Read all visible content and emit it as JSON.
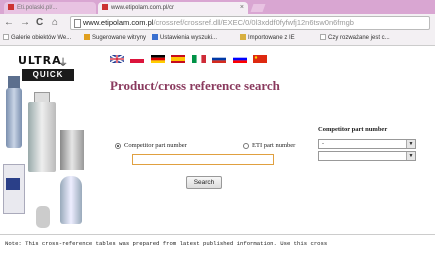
{
  "browser": {
    "tabs": [
      {
        "label": "Eti.polaski.pl/...",
        "active": false
      },
      {
        "label": "www.etipolam.com.pl/cr",
        "active": true
      }
    ],
    "nav": {
      "back": "←",
      "forward": "→",
      "reload": "C",
      "home": "⌂"
    },
    "url_host": "www.etipolam.com.pl",
    "url_path": "/crossref/crossref.dll/EXEC/0/0l3xddf0fyfwfj12n6tsw0n6fmgb",
    "bookmarks": [
      {
        "label": "Galerie obiektów We...",
        "color": "#ffffff"
      },
      {
        "label": "Sugerowane witryny",
        "color": "#e0a020"
      },
      {
        "label": "Ustawienia wyszuki...",
        "color": "#3a6fd0"
      },
      {
        "label": "Importowane z IE",
        "color": "#d8b040"
      },
      {
        "label": "Czy rozważane jest c...",
        "color": "#ffffff"
      }
    ]
  },
  "logo": {
    "top": "ULTRA",
    "bottom": "QUICK"
  },
  "flags": [
    {
      "name": "uk-flag",
      "colors": [
        "#1f3a93",
        "#cf142b",
        "#ffffff"
      ]
    },
    {
      "name": "poland-flag",
      "colors": [
        "#ffffff",
        "#dc143c"
      ]
    },
    {
      "name": "germany-flag",
      "colors": [
        "#000000",
        "#dd0000",
        "#ffce00"
      ]
    },
    {
      "name": "spain-flag",
      "colors": [
        "#c60b1e",
        "#ffc400",
        "#c60b1e"
      ]
    },
    {
      "name": "italy-flag",
      "colors": [
        "#009246",
        "#ffffff",
        "#ce2b37"
      ]
    },
    {
      "name": "russia-flag",
      "colors": [
        "#ffffff",
        "#0039a6",
        "#d52b1e"
      ]
    },
    {
      "name": "slovenia-flag",
      "colors": [
        "#ffffff",
        "#0000ff",
        "#ff0000"
      ]
    },
    {
      "name": "china-flag",
      "colors": [
        "#de2910"
      ]
    }
  ],
  "page": {
    "title": "Product/cross reference search",
    "radio_competitor": "Competitor part number",
    "radio_eti": "ETI part number",
    "competitor_header": "Competitor part number",
    "search_value": "",
    "select1_value": "-",
    "select2_value": "",
    "search_button": "Search",
    "note": "Note: This cross-reference tables was prepared from latest published information. Use this cross"
  }
}
